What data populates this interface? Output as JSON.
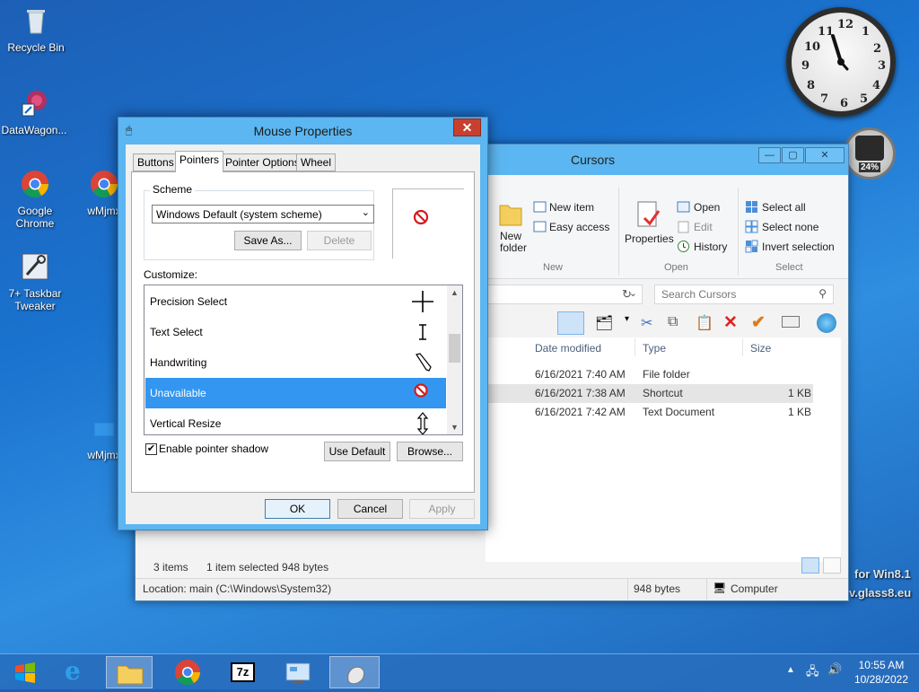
{
  "desktop": {
    "icons": [
      {
        "label": "Recycle Bin"
      },
      {
        "label": "DataWagon..."
      },
      {
        "label": "Google Chrome"
      },
      {
        "label": "wMjmx"
      },
      {
        "label": "7+ Taskbar Tweaker"
      },
      {
        "label": "wMjmx"
      }
    ],
    "clock_numbers": [
      "12",
      "1",
      "2",
      "3",
      "4",
      "5",
      "6",
      "7",
      "8",
      "9",
      "10",
      "11"
    ],
    "gauge_text": "24%",
    "watermark_1": "for Win8.1",
    "watermark_2": "v.glass8.eu"
  },
  "explorer": {
    "title": "Cursors",
    "min": "—",
    "max": "▢",
    "close": "✕",
    "ribbon": {
      "new_folder": "New folder",
      "new_item": "New item",
      "easy_access": "Easy access",
      "properties": "Properties",
      "open": "Open",
      "edit": "Edit",
      "history": "History",
      "select_all": "Select all",
      "select_none": "Select none",
      "invert_selection": "Invert selection",
      "group_new": "New",
      "group_open": "Open",
      "group_select": "Select"
    },
    "search_placeholder": "Search Cursors",
    "columns": {
      "date": "Date modified",
      "type": "Type",
      "size": "Size"
    },
    "rows": [
      {
        "date": "6/16/2021 7:40 AM",
        "type": "File folder",
        "size": ""
      },
      {
        "date": "6/16/2021 7:38 AM",
        "type": "Shortcut",
        "size": "1 KB"
      },
      {
        "date": "6/16/2021 7:42 AM",
        "type": "Text Document",
        "size": "1 KB"
      }
    ],
    "status_items": "3 items",
    "status_selected": "1 item selected  948 bytes",
    "location": "Location: main (C:\\Windows\\System32)",
    "loc_size": "948 bytes",
    "loc_computer": "Computer"
  },
  "dialog": {
    "title": "Mouse Properties",
    "close": "✕",
    "tabs": [
      "Buttons",
      "Pointers",
      "Pointer Options",
      "Wheel"
    ],
    "scheme_label": "Scheme",
    "scheme_value": "Windows Default (system scheme)",
    "save_as": "Save As...",
    "delete": "Delete",
    "customize_label": "Customize:",
    "cursors": [
      {
        "name": "Precision Select",
        "icon": "crosshair-icon"
      },
      {
        "name": "Text Select",
        "icon": "ibeam-icon"
      },
      {
        "name": "Handwriting",
        "icon": "pen-icon"
      },
      {
        "name": "Unavailable",
        "icon": "unavailable-icon"
      },
      {
        "name": "Vertical Resize",
        "icon": "vertical-resize-icon"
      }
    ],
    "selected_index": 3,
    "enable_shadow": "Enable pointer shadow",
    "use_default": "Use Default",
    "browse": "Browse...",
    "ok": "OK",
    "cancel": "Cancel",
    "apply": "Apply"
  },
  "taskbar": {
    "time": "10:55 AM",
    "date": "10/28/2022"
  }
}
